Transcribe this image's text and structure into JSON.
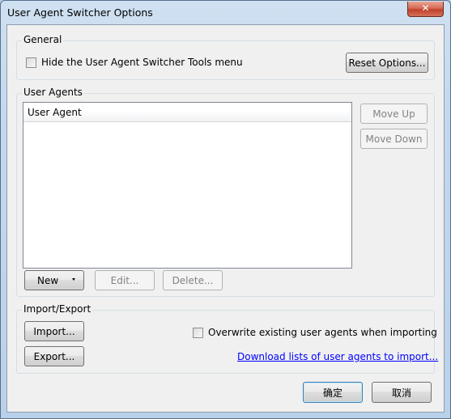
{
  "window": {
    "title": "User Agent Switcher Options",
    "close_glyph": "✕"
  },
  "general": {
    "label": "General",
    "hide_menu_label": "Hide the User Agent Switcher Tools menu",
    "hide_menu_checked": false,
    "reset_button": "Reset Options..."
  },
  "user_agents": {
    "label": "User Agents",
    "column_header": "User Agent",
    "rows": [],
    "move_up": "Move Up",
    "move_down": "Move Down",
    "new": "New",
    "edit": "Edit...",
    "delete": "Delete..."
  },
  "import_export": {
    "label": "Import/Export",
    "import": "Import...",
    "export": "Export...",
    "overwrite_label": "Overwrite existing user agents when importing",
    "overwrite_checked": false,
    "download_link": "Download lists of user agents to import..."
  },
  "footer": {
    "ok": "确定",
    "cancel": "取消"
  }
}
